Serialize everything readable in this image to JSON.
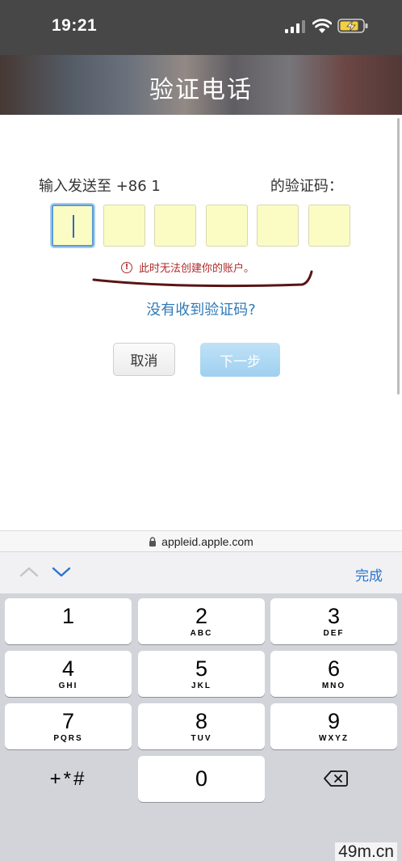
{
  "status_bar": {
    "time": "19:21",
    "icons": [
      "signal-icon",
      "wifi-icon",
      "battery-charging-icon"
    ]
  },
  "page": {
    "title": "验证电话",
    "prompt_prefix": "输入发送至 +86 1",
    "prompt_suffix": "的验证码：",
    "code_digit_count": 6,
    "error_message": "此时无法创建你的账户。",
    "resend_link": "没有收到验证码?",
    "cancel_button": "取消",
    "next_button": "下一步"
  },
  "browser": {
    "url": "appleid.apple.com"
  },
  "keyboard": {
    "done_label": "完成",
    "keys": [
      {
        "digit": "1",
        "letters": ""
      },
      {
        "digit": "2",
        "letters": "ABC"
      },
      {
        "digit": "3",
        "letters": "DEF"
      },
      {
        "digit": "4",
        "letters": "GHI"
      },
      {
        "digit": "5",
        "letters": "JKL"
      },
      {
        "digit": "6",
        "letters": "MNO"
      },
      {
        "digit": "7",
        "letters": "PQRS"
      },
      {
        "digit": "8",
        "letters": "TUV"
      },
      {
        "digit": "9",
        "letters": "WXYZ"
      },
      {
        "digit": "0",
        "letters": ""
      }
    ],
    "symbols_key": "+*#"
  },
  "watermark": "49m.cn",
  "colors": {
    "link": "#2f7ab8",
    "error": "#b02a2a",
    "code_box_fill": "#fbfbc4",
    "done": "#2a74d0"
  }
}
